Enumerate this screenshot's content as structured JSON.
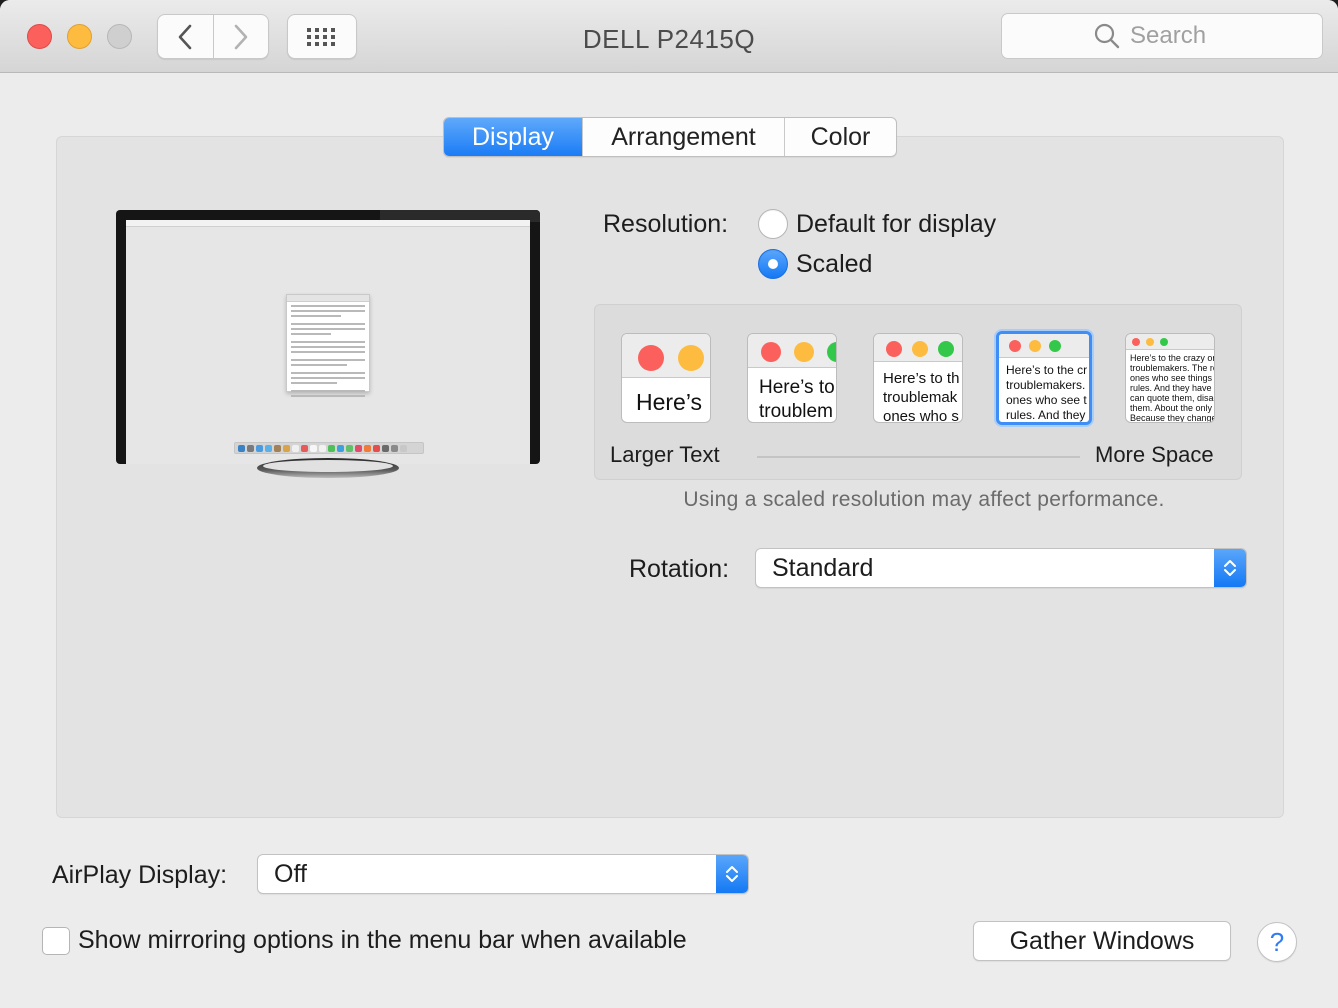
{
  "window": {
    "title": "DELL P2415Q",
    "search_placeholder": "Search"
  },
  "tabs": [
    {
      "label": "Display",
      "active": true
    },
    {
      "label": "Arrangement",
      "active": false
    },
    {
      "label": "Color",
      "active": false
    }
  ],
  "resolution": {
    "label": "Resolution:",
    "options": [
      {
        "label": "Default for display",
        "selected": false
      },
      {
        "label": "Scaled",
        "selected": true
      }
    ],
    "scale_thumbnails": [
      {
        "text": "Here’s",
        "selected": false
      },
      {
        "text": "Here’s to\ntroublem",
        "selected": false
      },
      {
        "text": "Here’s to th\ntroublemak\nones who s",
        "selected": false
      },
      {
        "text": "Here’s to the cr\ntroublemakers.\nones who see t\nrules. And they",
        "selected": true
      },
      {
        "text": "Here’s to the crazy one\ntroublemakers. The rou\nones who see things dif\nrules. And they have no\ncan quote them, disagre\nthem. About the only th\nBecause they change th",
        "selected": false
      }
    ],
    "larger_text_label": "Larger Text",
    "more_space_label": "More Space",
    "note": "Using a scaled resolution may affect performance."
  },
  "rotation": {
    "label": "Rotation:",
    "value": "Standard"
  },
  "airplay": {
    "label": "AirPlay Display:",
    "value": "Off"
  },
  "mirroring": {
    "label": "Show mirroring options in the menu bar when available",
    "checked": false
  },
  "gather_windows_label": "Gather Windows",
  "help_label": "?",
  "colors": {
    "accent": "#1b7cf5",
    "close": "#fc605c",
    "minimize": "#fdbc40",
    "zoom_disabled": "#cfcfcf",
    "traffic_green": "#34c84a"
  },
  "icons": {
    "back": "chevron-left-icon",
    "forward": "chevron-right-icon",
    "show_all": "grid-icon",
    "search": "magnifier-icon",
    "popup": "up-down-arrows-icon"
  }
}
